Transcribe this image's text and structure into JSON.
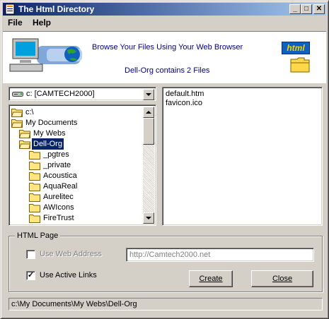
{
  "window": {
    "title": "The Html Directory",
    "minimize_symbol": "_",
    "maximize_symbol": "□",
    "close_symbol": "✕"
  },
  "menu": {
    "items": [
      {
        "label": "File"
      },
      {
        "label": "Help"
      }
    ]
  },
  "banner": {
    "tagline": "Browse Your Files Using Your Web Browser",
    "file_count_text": "Dell-Org contains 2 Files",
    "logo_text": "html"
  },
  "drive_select": {
    "value": "c: [CAMTECH2000]"
  },
  "folder_tree": {
    "items": [
      {
        "label": "c:\\",
        "icon": "folder-open-icon"
      },
      {
        "label": "My Documents",
        "icon": "folder-open-icon"
      },
      {
        "label": "My Webs",
        "icon": "folder-open-icon"
      },
      {
        "label": "Dell-Org",
        "icon": "folder-open-icon",
        "selected": true
      },
      {
        "label": "_pgtres",
        "icon": "folder-icon"
      },
      {
        "label": "_private",
        "icon": "folder-icon"
      },
      {
        "label": "Acoustica",
        "icon": "folder-icon"
      },
      {
        "label": "AquaReal",
        "icon": "folder-icon"
      },
      {
        "label": "Aurelitec",
        "icon": "folder-icon"
      },
      {
        "label": "AWIcons",
        "icon": "folder-icon"
      },
      {
        "label": "FireTrust",
        "icon": "folder-icon"
      }
    ]
  },
  "file_list": {
    "items": [
      "default.htm",
      "favicon.ico"
    ]
  },
  "html_page": {
    "group_label": "HTML Page",
    "use_web_address": {
      "label": "Use Web Address",
      "checked": false
    },
    "web_address": {
      "value": "http://Camtech2000.net"
    },
    "use_active_links": {
      "label": "Use Active Links",
      "checked": true
    },
    "create_button": "Create",
    "close_button": "Close"
  },
  "status": {
    "path": "c:\\My Documents\\My Webs\\Dell-Org"
  }
}
